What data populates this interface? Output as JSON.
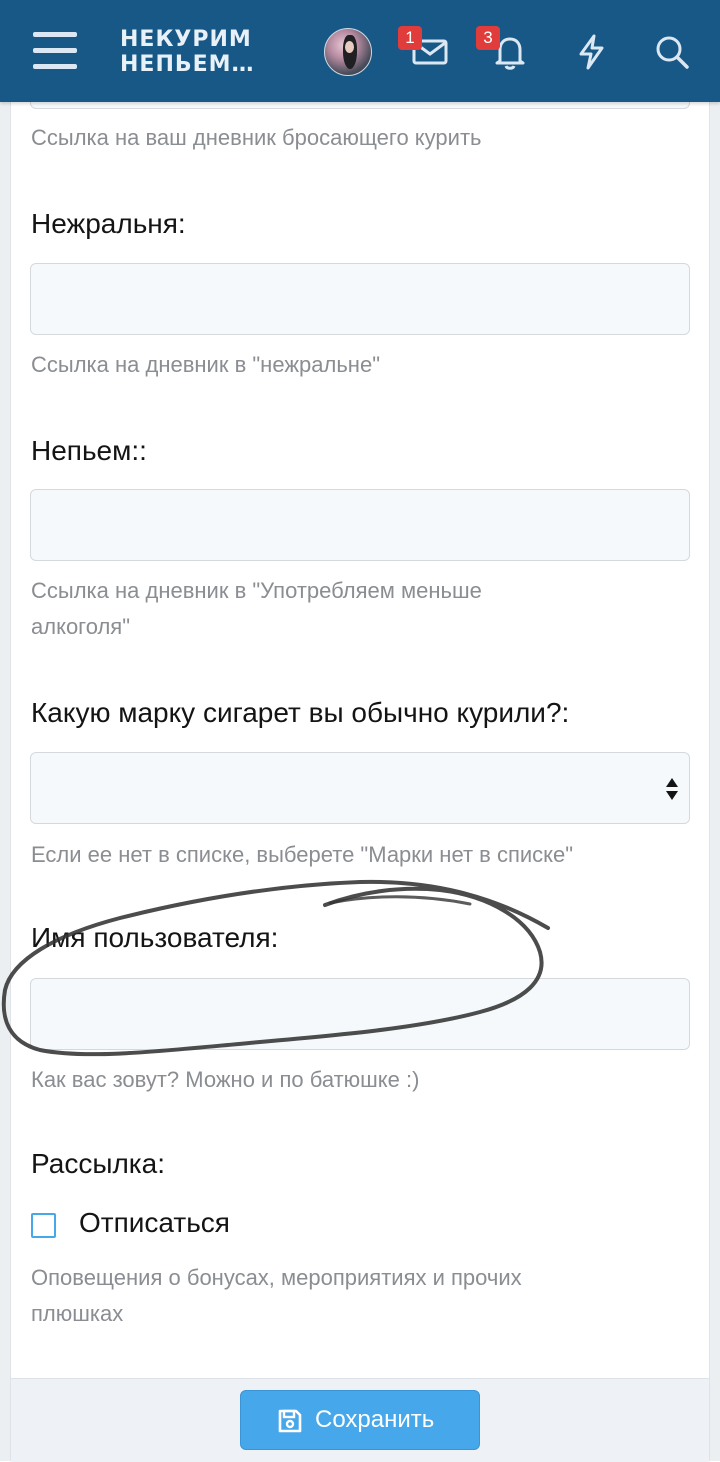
{
  "header": {
    "logo_line1": "НЕКУРИМ",
    "logo_line2": "НЕПЬЕМ…",
    "messages_badge": "1",
    "notifications_badge": "3",
    "icons": [
      "menu-icon",
      "envelope-icon",
      "bell-icon",
      "lightning-icon",
      "search-icon"
    ]
  },
  "form": {
    "diary_hint": "Ссылка на ваш дневник бросающего курить",
    "nezhralnya_label": "Нежральня:",
    "nezhralnya_value": "",
    "nezhralnya_hint": "Ссылка на дневник в \"нежральне\"",
    "nepyem_label": "Непьем::",
    "nepyem_value": "",
    "nepyem_hint_line1": "Ссылка на дневник в \"Употребляем меньше",
    "nepyem_hint_line2": "алкоголя\"",
    "brand_label": "Какую марку сигарет вы обычно курили?:",
    "brand_value": "",
    "brand_hint": "Если ее нет в списке, выберете \"Марки нет в списке\"",
    "username_label": "Имя пользователя:",
    "username_value": "",
    "username_hint": "Как вас зовут? Можно и по батюшке :)",
    "mailing_label": "Рассылка:",
    "unsubscribe_label": "Отписаться",
    "unsubscribe_checked": false,
    "mailing_hint_line1": "Оповещения о бонусах, мероприятиях и прочих",
    "mailing_hint_line2": "плюшках"
  },
  "footer": {
    "save_label": "Сохранить"
  },
  "colors": {
    "header_bg": "#185886",
    "accent": "#47a7eb",
    "badge": "#e03c3c",
    "hint_text": "#8a8d91"
  }
}
